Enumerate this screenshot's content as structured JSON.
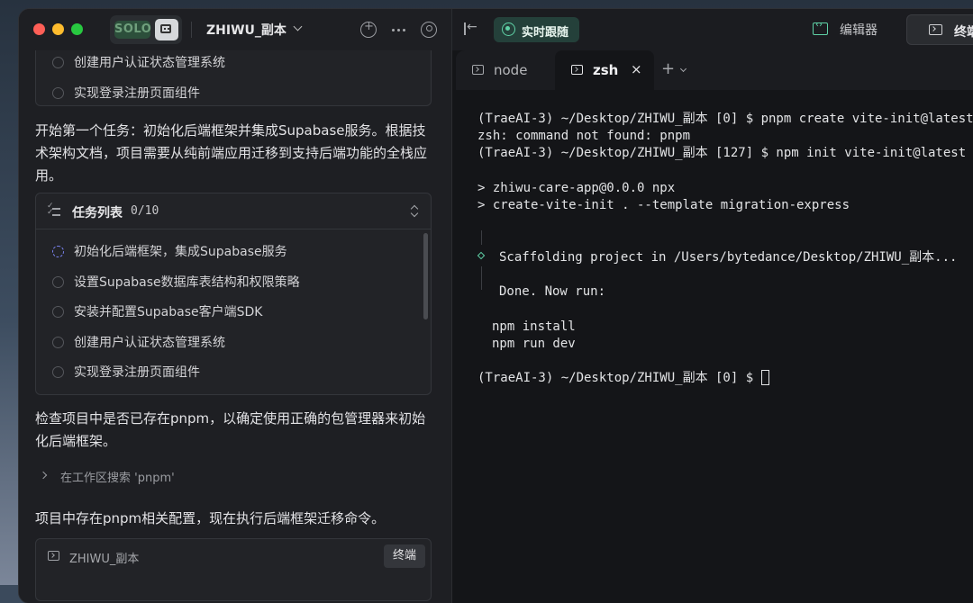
{
  "app": {
    "mode_badge": "SOLO",
    "project_title": "ZHIWU_副本"
  },
  "chat": {
    "top_tasks": [
      "创建用户认证状态管理系统",
      "实现登录注册页面组件"
    ],
    "message_1": "开始第一个任务：初始化后端框架并集成Supabase服务。根据技术架构文档，项目需要从纯前端应用迁移到支持后端功能的全栈应用。",
    "task_list": {
      "title": "任务列表",
      "count": "0/10",
      "items": [
        "初始化后端框架，集成Supabase服务",
        "设置Supabase数据库表结构和权限策略",
        "安装并配置Supabase客户端SDK",
        "创建用户认证状态管理系统",
        "实现登录注册页面组件"
      ]
    },
    "message_2": "检查项目中是否已存在pnpm，以确定使用正确的包管理器来初始化后端框架。",
    "search_step": "在工作区搜索 'pnpm'",
    "message_3": "项目中存在pnpm相关配置，现在执行后端框架迁移命令。",
    "terminal_card": {
      "title": "ZHIWU_副本",
      "button": "终端"
    }
  },
  "toolbar": {
    "follow_label": "实时跟随",
    "editor_label": "编辑器",
    "terminal_label": "终端"
  },
  "tabs": {
    "node": "node",
    "zsh": "zsh",
    "close": "×",
    "add": "+"
  },
  "terminal": {
    "lines": [
      "(TraeAI-3) ~/Desktop/ZHIWU_副本 [0] $ pnpm create vite-init@latest",
      "zsh: command not found: pnpm",
      "(TraeAI-3) ~/Desktop/ZHIWU_副本 [127] $ npm init vite-init@latest",
      "> zhiwu-care-app@0.0.0 npx",
      "> create-vite-init . --template migration-express",
      "Scaffolding project in /Users/bytedance/Desktop/ZHIWU_副本...",
      "Done. Now run:",
      "npm install",
      "npm run dev",
      "(TraeAI-3) ~/Desktop/ZHIWU_副本 [0] $ "
    ]
  },
  "colors": {
    "accent_green": "#5fd1a6",
    "task_active": "#7a83f0"
  }
}
